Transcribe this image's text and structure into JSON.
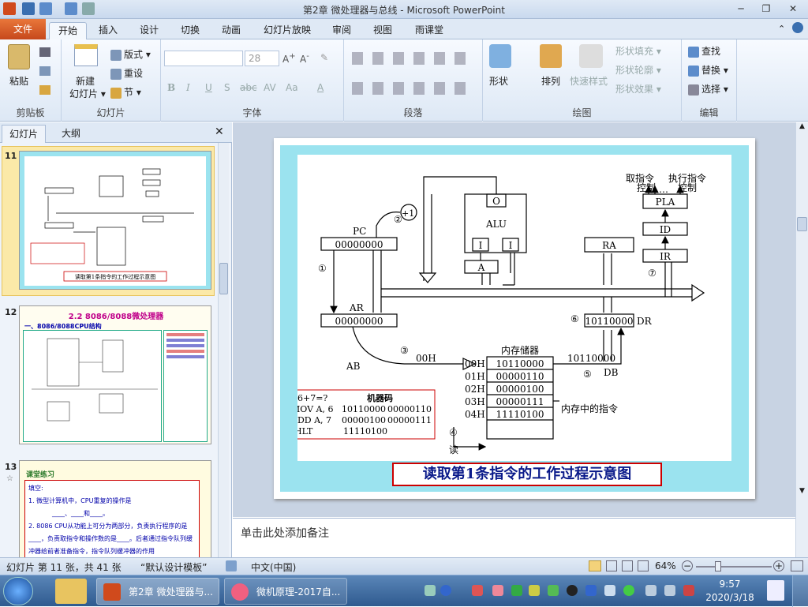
{
  "window": {
    "title": "第2章 微处理器与总线 - Microsoft PowerPoint",
    "minimize": "─",
    "restore": "❐",
    "close": "✕"
  },
  "tabs": {
    "file": "文件",
    "home": "开始",
    "insert": "插入",
    "design": "设计",
    "transitions": "切换",
    "animations": "动画",
    "slideshow": "幻灯片放映",
    "review": "审阅",
    "view": "视图",
    "rain": "雨课堂"
  },
  "ribbon": {
    "clipboard": {
      "label": "剪贴板",
      "paste": "粘贴"
    },
    "slides": {
      "label": "幻灯片",
      "new_slide": "新建",
      "new_slide2": "幻灯片 ▾",
      "layout": "版式 ▾",
      "reset": "重设",
      "section": "节 ▾"
    },
    "font": {
      "label": "字体",
      "size": "28",
      "bold": "B",
      "italic": "I",
      "underline": "U",
      "shadow": "S",
      "strike": "abc",
      "spacing": "AV",
      "case": "Aa",
      "color": "A"
    },
    "paragraph": {
      "label": "段落"
    },
    "drawing": {
      "label": "绘图",
      "shapes": "形状",
      "arrange": "排列",
      "quick_styles": "快速样式",
      "shape_fill": "形状填充 ▾",
      "shape_outline": "形状轮廓 ▾",
      "shape_effects": "形状效果 ▾"
    },
    "editing": {
      "label": "编辑",
      "find": "查找",
      "replace": "替换 ▾",
      "select": "选择 ▾"
    }
  },
  "left_pane": {
    "tab_slides": "幻灯片",
    "tab_outline": "大纲",
    "close": "✕"
  },
  "thumbnails": [
    {
      "num": "11",
      "caption": "读取第1条指令的工作过程示意图"
    },
    {
      "num": "12",
      "title": "2.2 8086/8088微处理器",
      "subtitle": "一、8086/8088CPU结构"
    },
    {
      "num": "13",
      "heading": "课堂练习",
      "q_title": "填空:",
      "q1": "1. 微型计算机中，CPU重复的操作是",
      "q1b": "____、____和____。",
      "q2": "2. 8086 CPU从功能上可分为两部分，负责执行程序的是____，负责取指令和操作数的是____。后者通过指令队列缓冲器给前者准备指令，指令队列缓冲器的作用"
    }
  ],
  "slide": {
    "caption": "读取第1条指令的工作过程示意图",
    "top_labels": {
      "fetch": "取指令",
      "exec": "执行指令",
      "ctrl1": "控制",
      "ctrl2": "控制",
      "dots": "…"
    },
    "blocks": {
      "pla": "PLA",
      "id": "ID",
      "ir": "IR",
      "ra": "RA",
      "alu": "ALU",
      "o": "O",
      "i1": "I",
      "i2": "I",
      "a": "A",
      "pc": "PC",
      "pc_val": "00000000",
      "ar": "AR",
      "ar_val": "00000000",
      "dr_val": "10110000",
      "dr": "DR",
      "plus1": "+1"
    },
    "steps": {
      "s1": "①",
      "s2": "②",
      "s3": "③",
      "s4": "④",
      "s5": "⑤",
      "s6": "⑥",
      "s7": "⑦"
    },
    "bus": {
      "ab": "AB",
      "db": "DB",
      "addr": "00H",
      "data": "10110000",
      "read": "读"
    },
    "memory": {
      "title": "内存储器",
      "addrs": [
        "00H",
        "01H",
        "02H",
        "03H",
        "04H"
      ],
      "cells": [
        "10110000",
        "00000110",
        "00000100",
        "00000111",
        "11110100"
      ],
      "note": "内存中的指令"
    },
    "code": {
      "header": "6+7=?",
      "mc_header": "机器码",
      "rows": [
        [
          "MOV A, 6",
          "10110000",
          "00000110"
        ],
        [
          "ADD A, 7",
          "00000100",
          "00000111"
        ],
        [
          "HLT",
          "11110100",
          ""
        ]
      ]
    }
  },
  "notes": "单击此处添加备注",
  "status": {
    "slide_info": "幻灯片 第 11 张，共 41 张",
    "template": "“默认设计模板”",
    "language": "中文(中国)",
    "zoom": "64%"
  },
  "taskbar": {
    "ppt": "第2章 微处理器与...",
    "browser": "微机原理-2017自...",
    "time": "9:57",
    "date": "2020/3/18"
  },
  "colors": {
    "file_tab": "#d65a26",
    "slide_border": "#9be3ef",
    "caption_border": "#cc0000",
    "code_border": "#cc0000"
  }
}
